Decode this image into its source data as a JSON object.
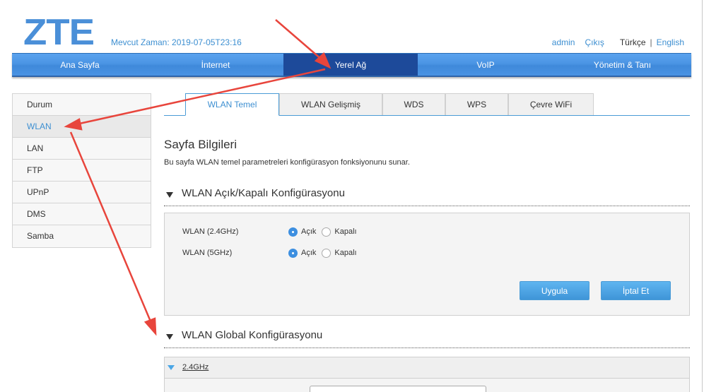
{
  "header": {
    "logo": "ZTE",
    "time_label": "Mevcut Zaman:",
    "time_value": "2019-07-05T23:16",
    "user": "admin",
    "logout": "Çıkış",
    "lang_current": "Türkçe",
    "lang_separator": "|",
    "lang_other": "English"
  },
  "mainnav": {
    "items": [
      {
        "label": "Ana Sayfa",
        "active": false
      },
      {
        "label": "İnternet",
        "active": false
      },
      {
        "label": "Yerel Ağ",
        "active": true
      },
      {
        "label": "VoIP",
        "active": false
      },
      {
        "label": "Yönetim & Tanı",
        "active": false
      }
    ]
  },
  "sidebar": {
    "items": [
      {
        "label": "Durum",
        "active": false
      },
      {
        "label": "WLAN",
        "active": true
      },
      {
        "label": "LAN",
        "active": false
      },
      {
        "label": "FTP",
        "active": false
      },
      {
        "label": "UPnP",
        "active": false
      },
      {
        "label": "DMS",
        "active": false
      },
      {
        "label": "Samba",
        "active": false
      }
    ]
  },
  "tabs": [
    {
      "label": "WLAN Temel",
      "active": true
    },
    {
      "label": "WLAN Gelişmiş",
      "active": false
    },
    {
      "label": "WDS",
      "active": false
    },
    {
      "label": "WPS",
      "active": false
    },
    {
      "label": "Çevre WiFi",
      "active": false
    }
  ],
  "page": {
    "title": "Sayfa Bilgileri",
    "description": "Bu sayfa WLAN temel parametreleri konfigürasyon fonksiyonunu sunar."
  },
  "section_onoff": {
    "title": "WLAN Açık/Kapalı Konfigürasyonu",
    "rows": [
      {
        "label": "WLAN (2.4GHz)",
        "on_label": "Açık",
        "off_label": "Kapalı",
        "value": "on"
      },
      {
        "label": "WLAN (5GHz)",
        "on_label": "Açık",
        "off_label": "Kapalı",
        "value": "on"
      }
    ],
    "apply_label": "Uygula",
    "cancel_label": "İptal Et"
  },
  "section_global": {
    "title": "WLAN Global Konfigürasyonu",
    "band_label": "2.4GHz"
  },
  "colors": {
    "accent": "#3d8fd1",
    "nav_active": "#1d4a9a",
    "annotation_arrow": "#e8453c"
  }
}
